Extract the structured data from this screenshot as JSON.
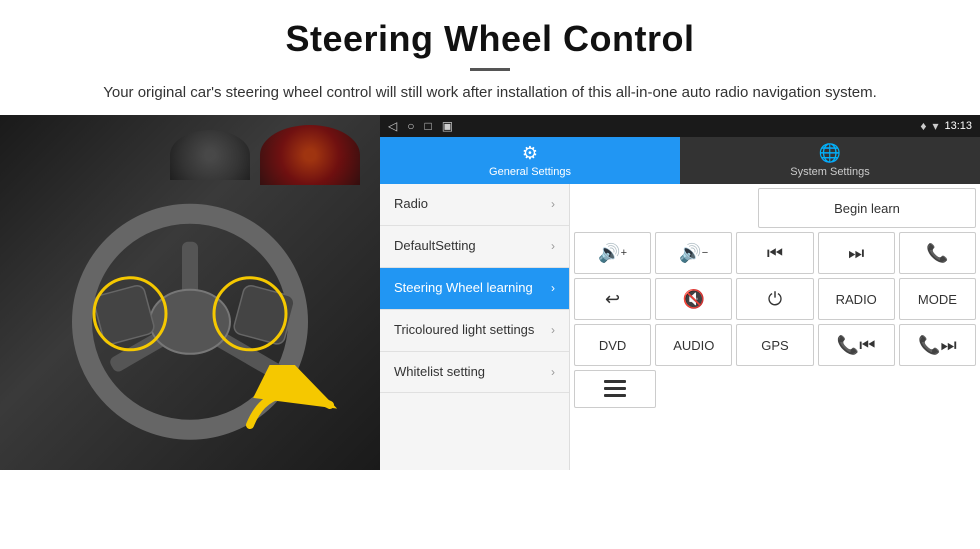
{
  "header": {
    "title": "Steering Wheel Control",
    "description": "Your original car's steering wheel control will still work after installation of this all-in-one auto radio navigation system."
  },
  "status_bar": {
    "back_icon": "◁",
    "home_icon": "○",
    "recents_icon": "□",
    "screenshot_icon": "▣",
    "gps_icon": "♦",
    "signal_icon": "▾",
    "time": "13:13"
  },
  "tabs": [
    {
      "id": "general",
      "label": "General Settings",
      "icon": "⚙",
      "active": true
    },
    {
      "id": "system",
      "label": "System Settings",
      "icon": "🌐",
      "active": false
    }
  ],
  "menu_items": [
    {
      "label": "Radio",
      "active": false
    },
    {
      "label": "DefaultSetting",
      "active": false
    },
    {
      "label": "Steering Wheel learning",
      "active": true
    },
    {
      "label": "Tricoloured light settings",
      "active": false
    },
    {
      "label": "Whitelist setting",
      "active": false
    }
  ],
  "right_panel": {
    "begin_learn_label": "Begin learn",
    "row1": [
      {
        "label": "🔊+",
        "type": "icon"
      },
      {
        "label": "🔊−",
        "type": "icon"
      },
      {
        "label": "⏮",
        "type": "icon"
      },
      {
        "label": "⏭",
        "type": "icon"
      },
      {
        "label": "📞",
        "type": "icon"
      }
    ],
    "row2": [
      {
        "label": "↩",
        "type": "icon"
      },
      {
        "label": "🔇",
        "type": "icon"
      },
      {
        "label": "⏻",
        "type": "icon"
      },
      {
        "label": "RADIO",
        "type": "text"
      },
      {
        "label": "MODE",
        "type": "text"
      }
    ],
    "row3": [
      {
        "label": "DVD",
        "type": "text"
      },
      {
        "label": "AUDIO",
        "type": "text"
      },
      {
        "label": "GPS",
        "type": "text"
      },
      {
        "label": "📞⏮",
        "type": "icon"
      },
      {
        "label": "📞⏭",
        "type": "icon"
      }
    ],
    "row4": [
      {
        "label": "≡",
        "type": "icon"
      }
    ]
  }
}
